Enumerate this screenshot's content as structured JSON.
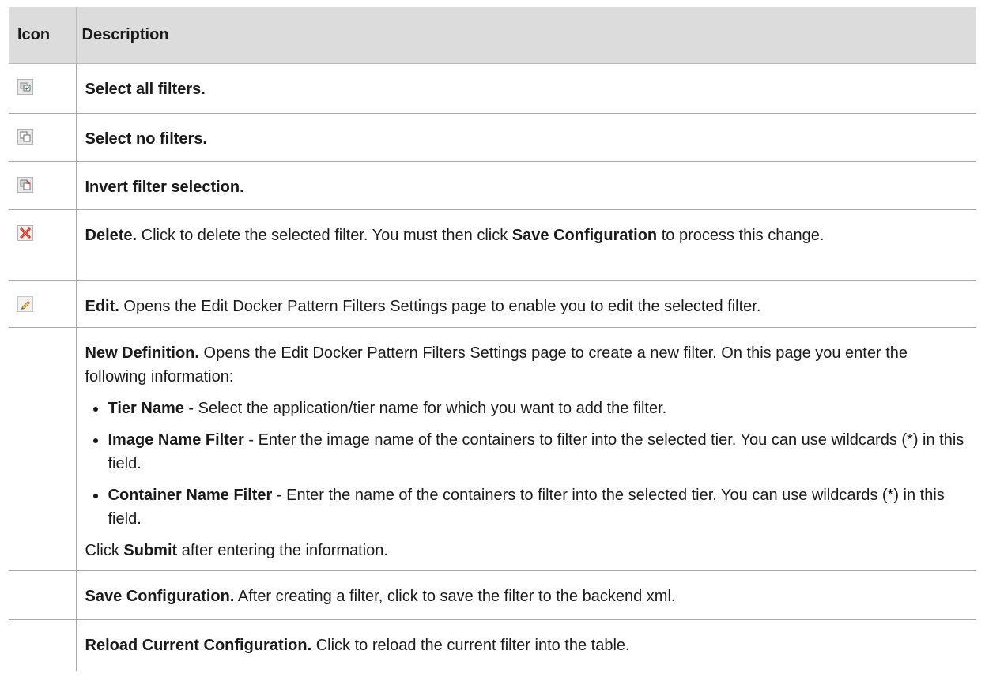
{
  "table": {
    "headers": {
      "icon": "Icon",
      "description": "Description"
    },
    "rows": [
      {
        "icon": "select-all-filters-icon",
        "title": "Select all filters."
      },
      {
        "icon": "select-no-filters-icon",
        "title": "Select no filters."
      },
      {
        "icon": "invert-filter-selection-icon",
        "title": "Invert filter selection."
      },
      {
        "icon": "delete-icon",
        "title": "Delete.",
        "text_a": " Click to delete the selected filter. You must then click ",
        "strong": "Save Configuration",
        "text_b": " to process this change."
      },
      {
        "icon": "edit-pencil-icon",
        "title": "Edit.",
        "text": " Opens the Edit Docker Pattern Filters Settings page to enable you to edit the selected filter."
      },
      {
        "title": "New Definition.",
        "text": " Opens the Edit Docker Pattern Filters Settings page to create a new filter. On this page you enter the following information:",
        "bullets": [
          {
            "term": "Tier Name",
            "text": " - Select the application/tier name for which you want to add the filter."
          },
          {
            "term": "Image Name Filter",
            "text": " - Enter the image name of the containers to filter into the selected tier. You can use wildcards (*) in this field."
          },
          {
            "term": "Container Name Filter",
            "text": " - Enter the name of the containers to filter into the selected tier. You can use wildcards (*) in this field."
          }
        ],
        "footer_a": "Click ",
        "footer_strong": "Submit",
        "footer_b": " after entering the information."
      },
      {
        "title": "Save Configuration.",
        "text": " After creating a filter, click to save the filter to the backend xml."
      },
      {
        "title": "Reload Current Configuration.",
        "text": " Click to reload the current filter into the table."
      }
    ]
  },
  "colors": {
    "header_bg": "#dcdcdc",
    "border": "#a8a8a8",
    "delete_red": "#d8261c"
  }
}
